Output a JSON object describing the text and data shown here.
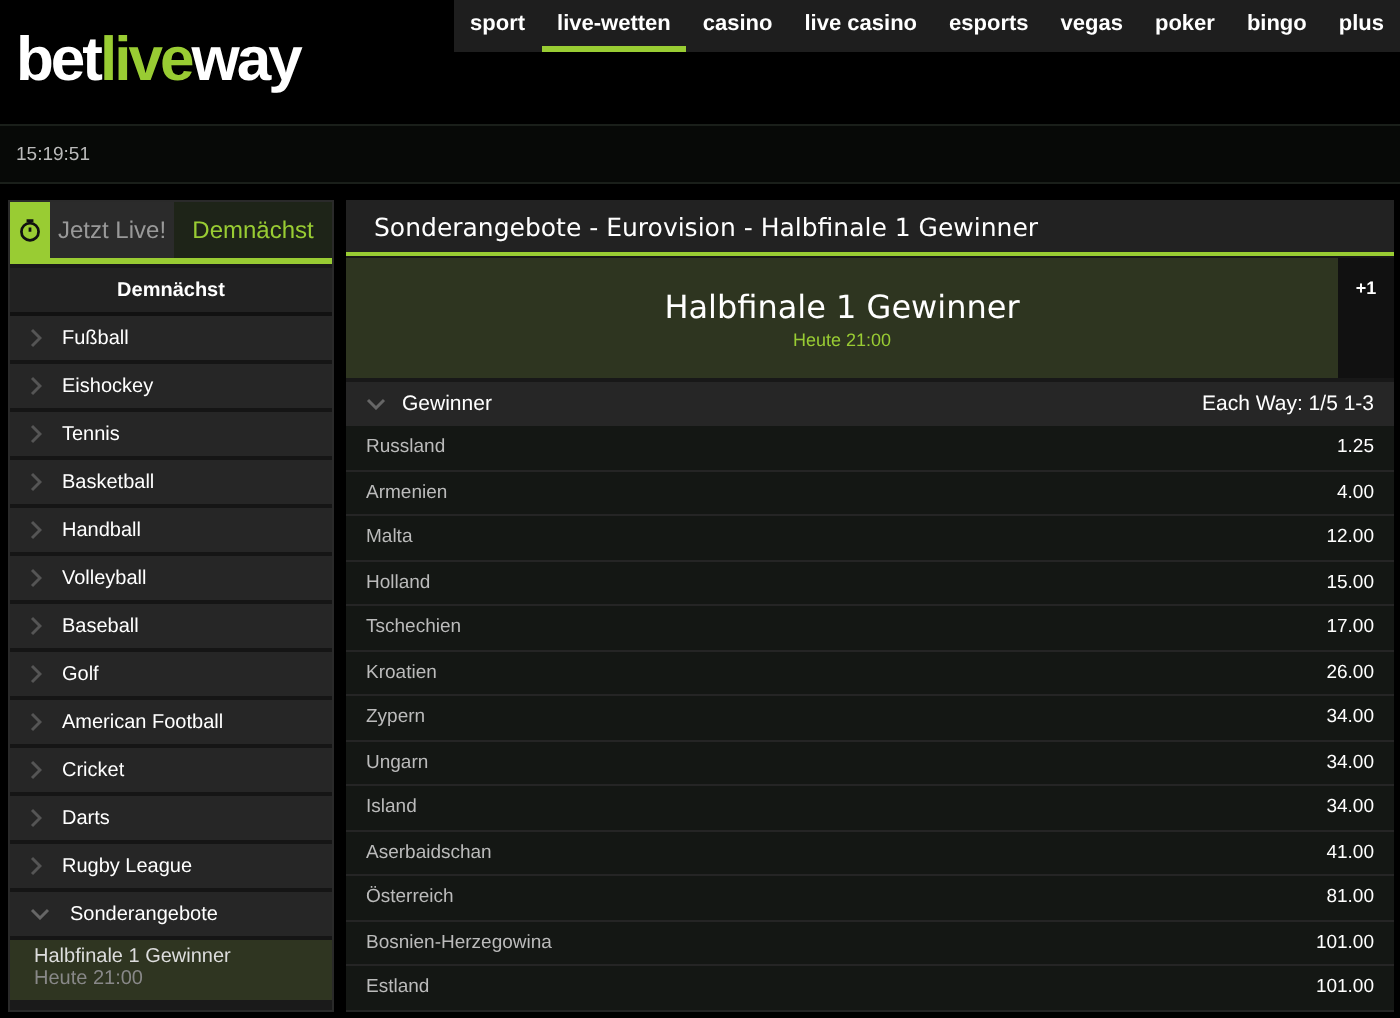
{
  "logo": {
    "part_1": "bet",
    "part_2": "live",
    "part_3": "way"
  },
  "nav": [
    {
      "label": "sport",
      "selected": false
    },
    {
      "label": "live-wetten",
      "selected": true
    },
    {
      "label": "casino",
      "selected": false
    },
    {
      "label": "live casino",
      "selected": false
    },
    {
      "label": "esports",
      "selected": false
    },
    {
      "label": "vegas",
      "selected": false
    },
    {
      "label": "poker",
      "selected": false
    },
    {
      "label": "bingo",
      "selected": false
    },
    {
      "label": "plus",
      "selected": false
    }
  ],
  "clock": "15:19:51",
  "sidebar": {
    "tabs": [
      {
        "label": "Jetzt Live!",
        "selected": false
      },
      {
        "label": "Demnächst",
        "selected": true
      }
    ],
    "heading": "Demnächst",
    "items": [
      {
        "label": "Fußball",
        "expanded": false
      },
      {
        "label": "Eishockey",
        "expanded": false
      },
      {
        "label": "Tennis",
        "expanded": false
      },
      {
        "label": "Basketball",
        "expanded": false
      },
      {
        "label": "Handball",
        "expanded": false
      },
      {
        "label": "Volleyball",
        "expanded": false
      },
      {
        "label": "Baseball",
        "expanded": false
      },
      {
        "label": "Golf",
        "expanded": false
      },
      {
        "label": "American Football",
        "expanded": false
      },
      {
        "label": "Cricket",
        "expanded": false
      },
      {
        "label": "Darts",
        "expanded": false
      },
      {
        "label": "Rugby League",
        "expanded": false
      },
      {
        "label": "Sonderangebote",
        "expanded": true,
        "children": [
          {
            "label": "Halbfinale 1 Gewinner",
            "time": "Heute 21:00",
            "selected": true
          }
        ]
      }
    ]
  },
  "main": {
    "title": "Sonderangebote - Eurovision - Halbfinale 1 Gewinner",
    "event": {
      "name": "Halbfinale 1 Gewinner",
      "time": "Heute 21:00",
      "more_markets": "+1"
    },
    "market": {
      "name": "Gewinner",
      "expanded": true,
      "each_way": "Each Way: 1/5 1-3",
      "rows": [
        {
          "name": "Russland",
          "odds": "1.25"
        },
        {
          "name": "Armenien",
          "odds": "4.00"
        },
        {
          "name": "Malta",
          "odds": "12.00"
        },
        {
          "name": "Holland",
          "odds": "15.00"
        },
        {
          "name": "Tschechien",
          "odds": "17.00"
        },
        {
          "name": "Kroatien",
          "odds": "26.00"
        },
        {
          "name": "Zypern",
          "odds": "34.00"
        },
        {
          "name": "Ungarn",
          "odds": "34.00"
        },
        {
          "name": "Island",
          "odds": "34.00"
        },
        {
          "name": "Aserbaidschan",
          "odds": "41.00"
        },
        {
          "name": "Österreich",
          "odds": "81.00"
        },
        {
          "name": "Bosnien-Herzegowina",
          "odds": "101.00"
        },
        {
          "name": "Estland",
          "odds": "101.00"
        }
      ]
    }
  }
}
